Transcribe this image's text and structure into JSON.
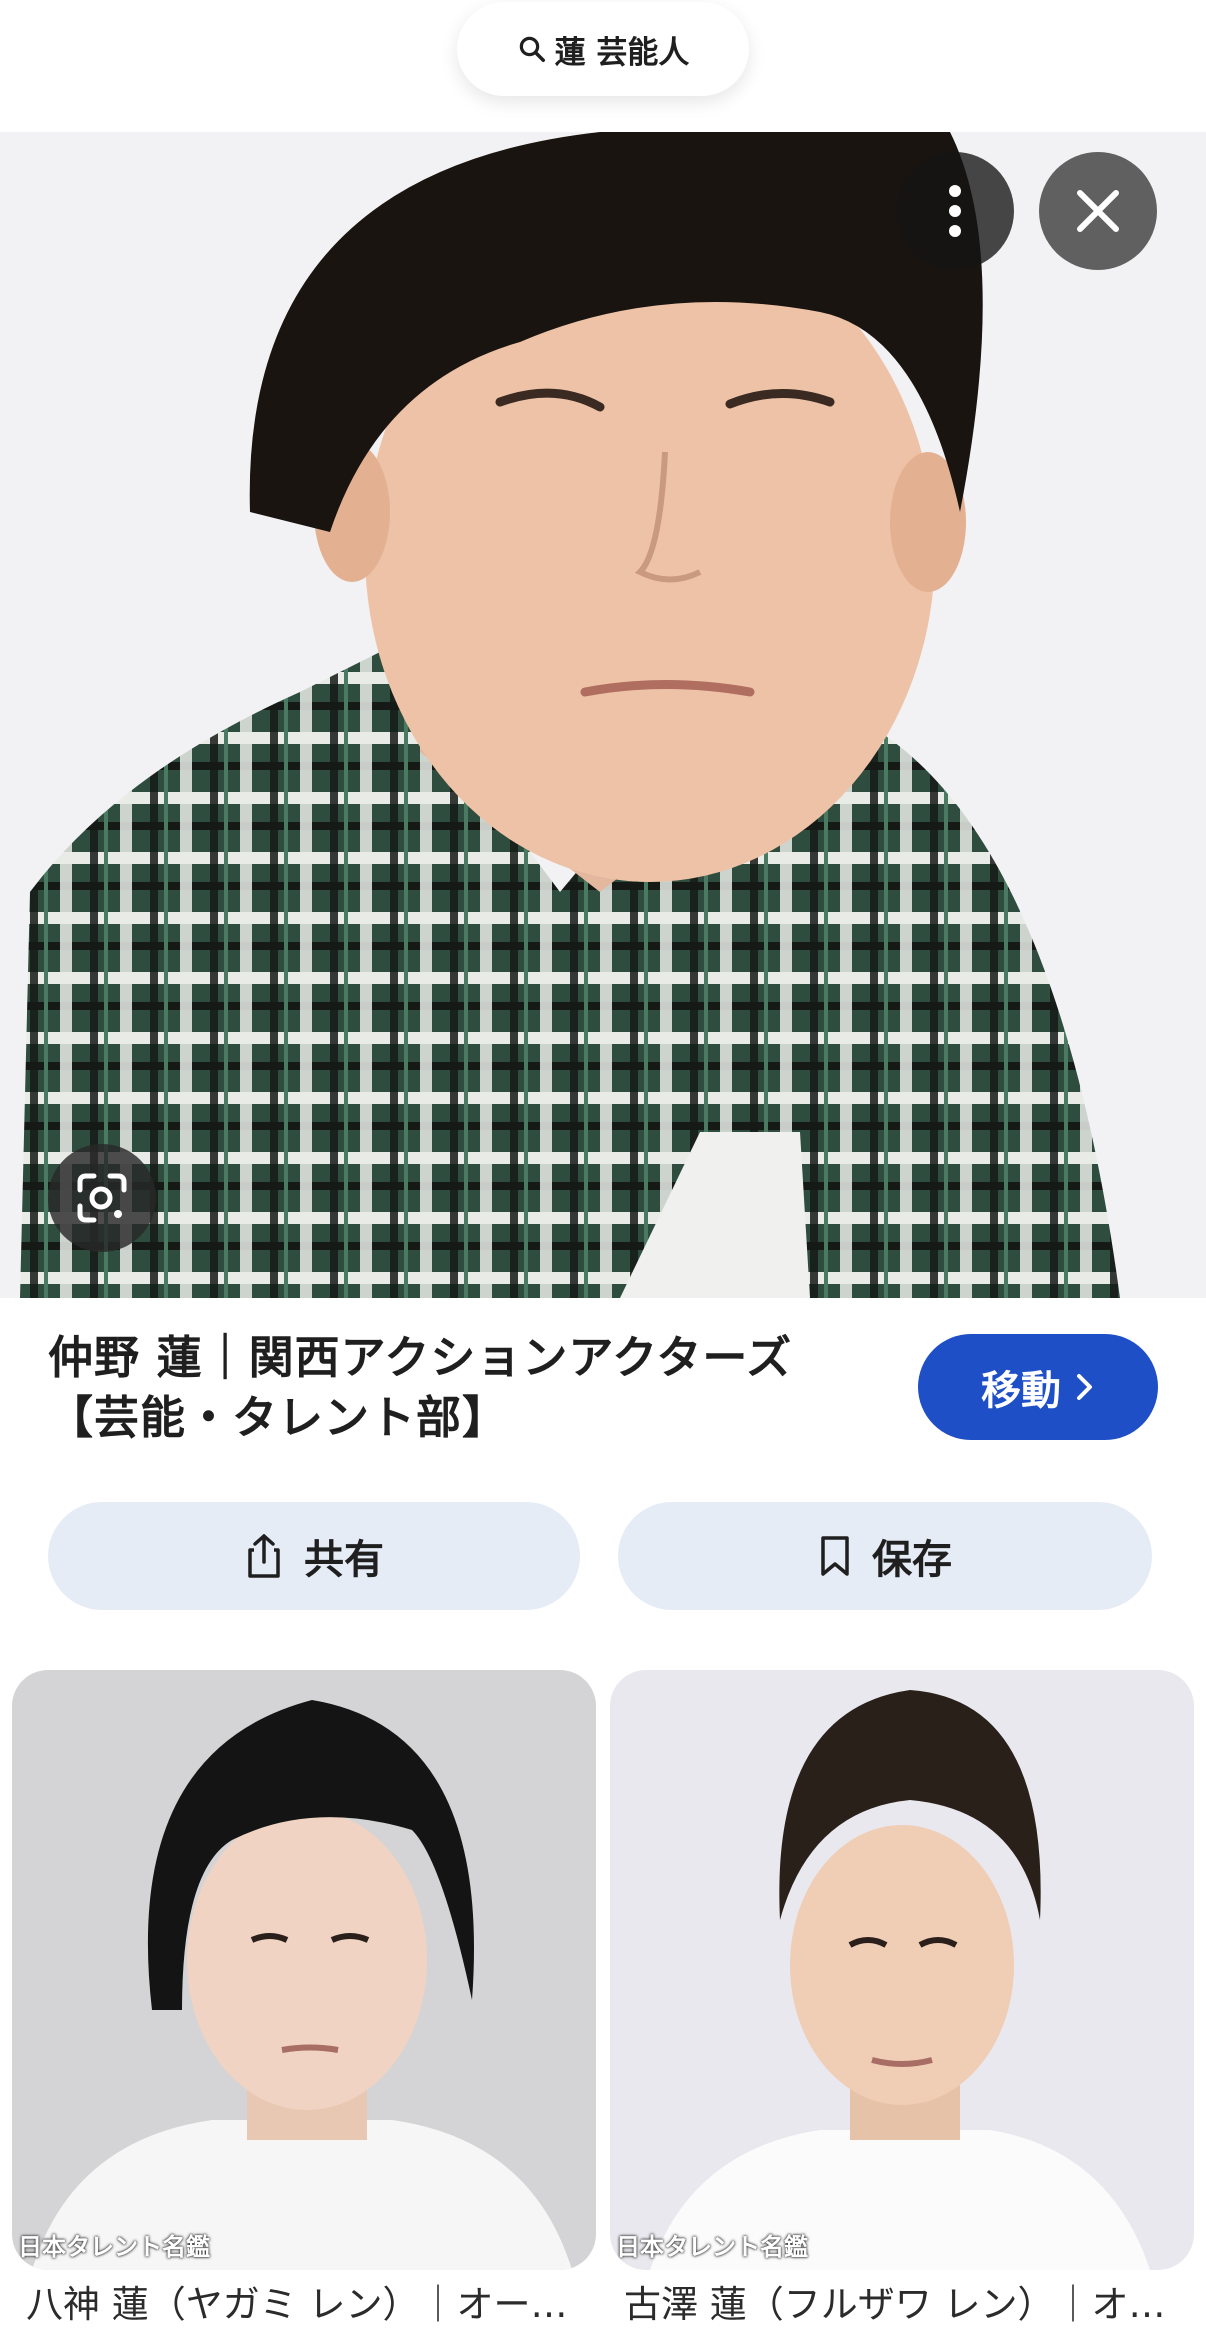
{
  "search": {
    "query": "蓮 芸能人",
    "icon": "search-icon"
  },
  "result": {
    "title_line1": "仲野 蓮｜関西アクションアクターズ",
    "title_line2": "【芸能・タレント部】",
    "visit_label": "移動"
  },
  "actions": {
    "share_label": "共有",
    "save_label": "保存"
  },
  "related": [
    {
      "watermark": "日本タレント名鑑",
      "caption": "八神 蓮（ヤガミ レン）｜オー…"
    },
    {
      "watermark": "日本タレント名鑑",
      "caption": "古澤 蓮（フルザワ レン）｜オ…"
    }
  ],
  "colors": {
    "accent": "#1e4fc6",
    "action_bg": "#e6ecf6"
  }
}
